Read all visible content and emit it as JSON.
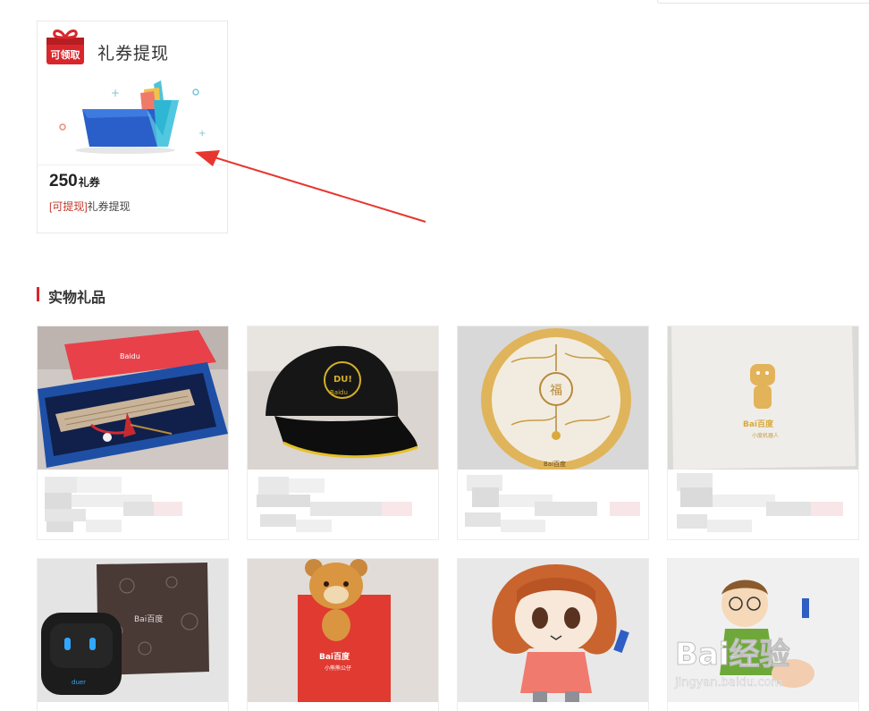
{
  "coupon": {
    "badge": "可领取",
    "title": "礼券提现",
    "amount": "250",
    "unit": "礼券",
    "tag": "[可提现]",
    "desc": "礼券提现"
  },
  "section": {
    "title": "实物礼品"
  },
  "products": [
    {
      "name": "",
      "photo": "百度书签礼盒",
      "logo": "Baidu"
    },
    {
      "name": "",
      "photo": "黑色棒球帽",
      "logo": "Baidu"
    },
    {
      "name": "",
      "photo": "木质福字灯",
      "logo": "Bai百度"
    },
    {
      "name": "",
      "photo": "度秘礼盒",
      "logo": "Bai百度",
      "sub": "小度机器人"
    },
    {
      "name": "",
      "photo": "小度机器人音箱",
      "logo": "Bai百度"
    },
    {
      "name": "",
      "photo": "小熊公仔",
      "logo": "Bai百度",
      "sub": "小熊熊公仔"
    },
    {
      "name": "",
      "photo": "短发娃娃公仔"
    },
    {
      "name": "",
      "photo": "眼镜男公仔",
      "watermark": "Bai经验",
      "watermark_url": "jingyan.baidu.com"
    }
  ],
  "colors": {
    "accent": "#d9262c",
    "border": "#ededed"
  }
}
